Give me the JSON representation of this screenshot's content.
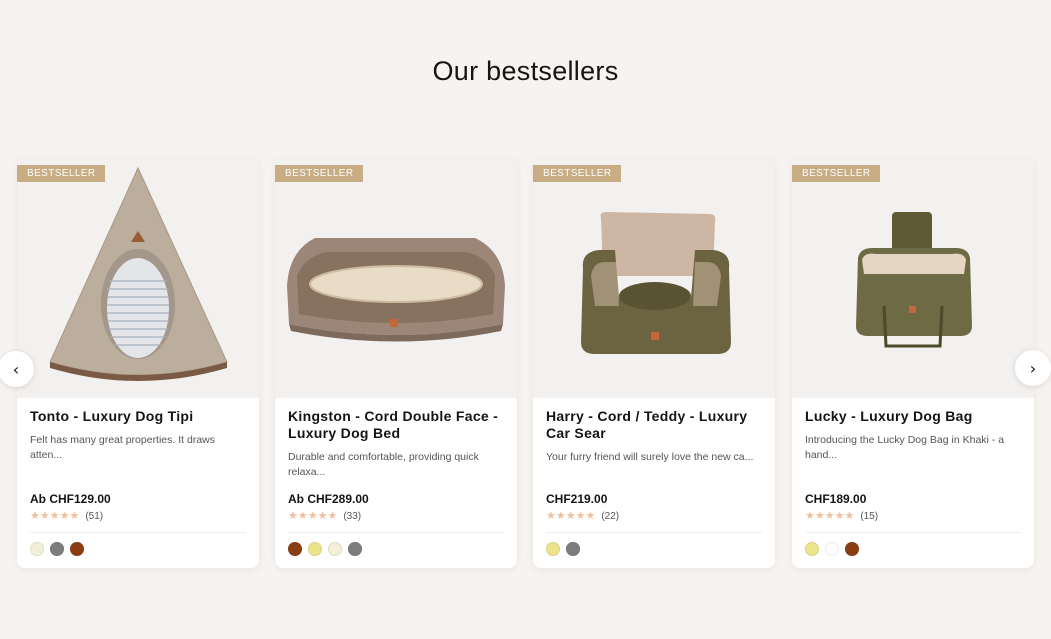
{
  "section": {
    "title": "Our bestsellers"
  },
  "carousel": {
    "prev_icon": "chevron-left-icon",
    "next_icon": "chevron-right-icon",
    "prev_glyph": "‹",
    "next_glyph": "›"
  },
  "products": [
    {
      "badge": "BESTSELLER",
      "name": "Tonto - Luxury Dog Tipi",
      "description": "Felt has many great properties. It draws atten...",
      "price": "Ab CHF129.00",
      "rating_stars": "★★★★★",
      "rating_value": 5,
      "review_count": "(51)",
      "swatches": [
        "#f2f0d6",
        "#7d7d7d",
        "#8b3e12"
      ]
    },
    {
      "badge": "BESTSELLER",
      "name": "Kingston - Cord Double Face - Luxury Dog Bed",
      "description": "Durable and comfortable, providing quick relaxa...",
      "price": "Ab CHF289.00",
      "rating_stars": "★★★★★",
      "rating_value": 5,
      "review_count": "(33)",
      "swatches": [
        "#8b3e12",
        "#ece48d",
        "#f2f0d6",
        "#7d7d7d"
      ]
    },
    {
      "badge": "BESTSELLER",
      "name": "Harry - Cord / Teddy - Luxury Car Sear",
      "description": "Your furry friend will surely love the new ca...",
      "price": "CHF219.00",
      "rating_stars": "★★★★★",
      "rating_value": 5,
      "review_count": "(22)",
      "swatches": [
        "#ece48d",
        "#7d7d7d"
      ]
    },
    {
      "badge": "BESTSELLER",
      "name": "Lucky - Luxury Dog Bag",
      "description": "Introducing the Lucky Dog Bag in Khaki - a hand...",
      "price": "CHF189.00",
      "rating_stars": "★★★★★",
      "rating_value": 5,
      "review_count": "(15)",
      "swatches": [
        "#ece48d",
        "#ffffff",
        "#8b3e12"
      ]
    }
  ],
  "colors": {
    "background": "#f7f3f0",
    "badge": "#c7ac84",
    "star": "#f0bf9c"
  }
}
